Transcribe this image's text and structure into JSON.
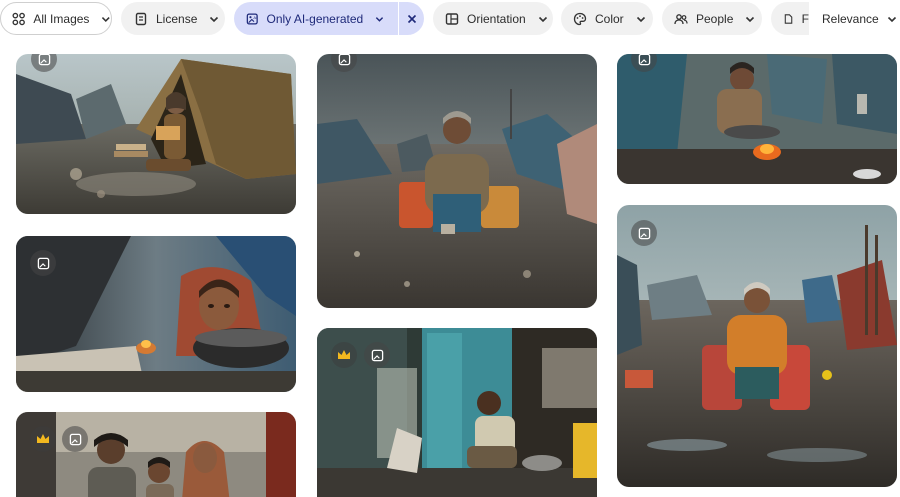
{
  "filters": {
    "all_images": {
      "label": "All Images",
      "icon": "grid-icon"
    },
    "license": {
      "label": "License",
      "icon": "document-icon"
    },
    "only_ai": {
      "label": "Only AI-generated",
      "icon": "ai-image-icon",
      "active": true,
      "active_color": "#d8dcfa"
    },
    "orientation": {
      "label": "Orientation",
      "icon": "orientation-icon"
    },
    "color": {
      "label": "Color",
      "icon": "palette-icon"
    },
    "people": {
      "label": "People",
      "icon": "people-icon"
    },
    "more": {
      "label": "F",
      "icon": "document-icon"
    },
    "sort": {
      "label": "Relevance"
    }
  },
  "images": [
    {
      "name": "refugee-girl-reading-tent",
      "ai_badge": true,
      "premium": false
    },
    {
      "name": "girl-with-pot-tent",
      "ai_badge": true,
      "premium": false
    },
    {
      "name": "family-group",
      "ai_badge": true,
      "premium": true
    },
    {
      "name": "old-man-sitting-suitcases",
      "ai_badge": true,
      "premium": false
    },
    {
      "name": "boy-blue-doorway",
      "ai_badge": true,
      "premium": true
    },
    {
      "name": "man-cooking-fire",
      "ai_badge": true,
      "premium": false
    },
    {
      "name": "old-man-red-suitcases",
      "ai_badge": true,
      "premium": false
    }
  ]
}
